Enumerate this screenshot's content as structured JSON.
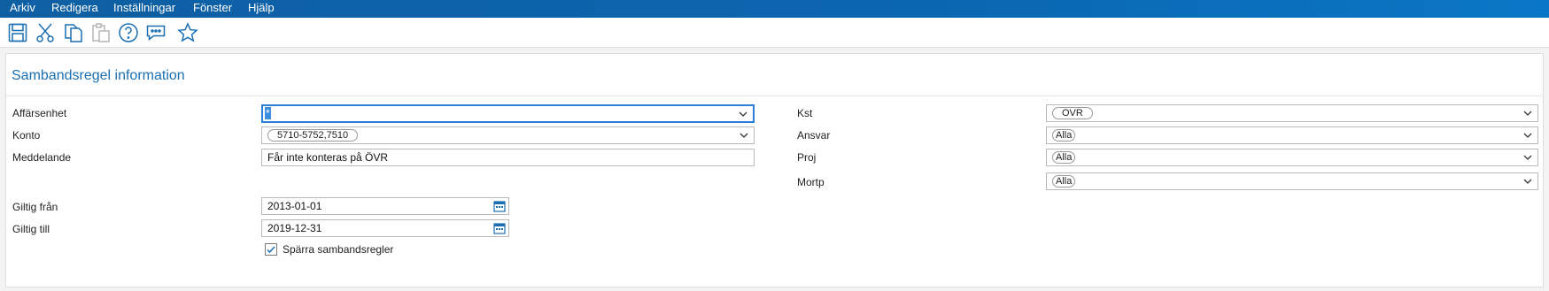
{
  "menu": [
    "Arkiv",
    "Redigera",
    "Inställningar",
    "Fönster",
    "Hjälp"
  ],
  "toolbar": {
    "icons": [
      "save-icon",
      "cut-icon",
      "copy-icon",
      "paste-icon",
      "help-icon",
      "comment-icon",
      "favorite-star-icon"
    ]
  },
  "panel": {
    "title": "Sambandsregel information"
  },
  "left": {
    "affarsenhet": {
      "label": "Affärsenhet",
      "value": "*"
    },
    "konto": {
      "label": "Konto",
      "value": "5710-5752,7510"
    },
    "meddelande": {
      "label": "Meddelande",
      "value": "Får inte konteras på ÖVR"
    },
    "giltig_fran": {
      "label": "Giltig från",
      "value": "2013-01-01"
    },
    "giltig_till": {
      "label": "Giltig till",
      "value": "2019-12-31"
    },
    "sparra": {
      "label": "Spärra sambandsregler",
      "checked": true
    }
  },
  "right": {
    "kst": {
      "label": "Kst",
      "value": "OVR"
    },
    "ansvar": {
      "label": "Ansvar",
      "value": "Alla"
    },
    "proj": {
      "label": "Proj",
      "value": "Alla"
    },
    "mortp": {
      "label": "Mortp",
      "value": "Alla"
    }
  },
  "colors": {
    "menubar": "#0b66b0",
    "accent": "#1a6fb3",
    "focus": "#2b7fd4"
  }
}
